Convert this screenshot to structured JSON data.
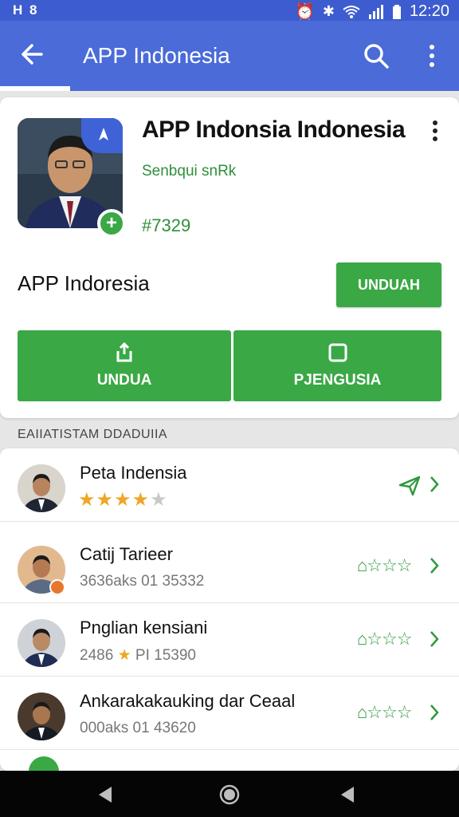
{
  "status_bar": {
    "left_text": "H 8",
    "time": "12:20"
  },
  "app_bar": {
    "title": "APP Indonesia",
    "back_icon": "back-arrow-icon",
    "search_icon": "search-icon",
    "more_icon": "more-vert-icon"
  },
  "app_card": {
    "name": "APP  Indonsia Indonesia",
    "subtitle": "Senbqui snRk",
    "code": "#7329",
    "label": "APP Indoresia",
    "install_button": "UNDUAH",
    "action_1": {
      "label": "UNDUA",
      "icon": "share-icon"
    },
    "action_2": {
      "label": "PJENGUSIA",
      "icon": "square-icon"
    }
  },
  "section_title": "EAIIATISTAM DDADUIIA",
  "list": [
    {
      "name": "Peta  Indensia",
      "rating": 4,
      "rating_max": 5,
      "action_icon": "send-icon"
    },
    {
      "name": "Catij  Tarieer",
      "meta": "3636aks  01 35332",
      "right_stars": "⌂☆☆☆",
      "badge": "orange"
    },
    {
      "name": "Pnglian kensiani",
      "meta_prefix": "2486",
      "meta_suffix": "PI 15390",
      "right_stars": "⌂☆☆☆"
    },
    {
      "name": "Ankarakakauking dar Ceaal",
      "meta": "000aks  01 43620",
      "right_stars": "⌂☆☆☆"
    }
  ],
  "nav_bar": {
    "back": "nav-back-icon",
    "home": "nav-home-icon",
    "recent": "nav-recent-icon"
  },
  "colors": {
    "app_bar": "#4a6bd8",
    "status_bar": "#3d5ccf",
    "accent_green": "#3aa845",
    "star_gold": "#f0a626"
  }
}
